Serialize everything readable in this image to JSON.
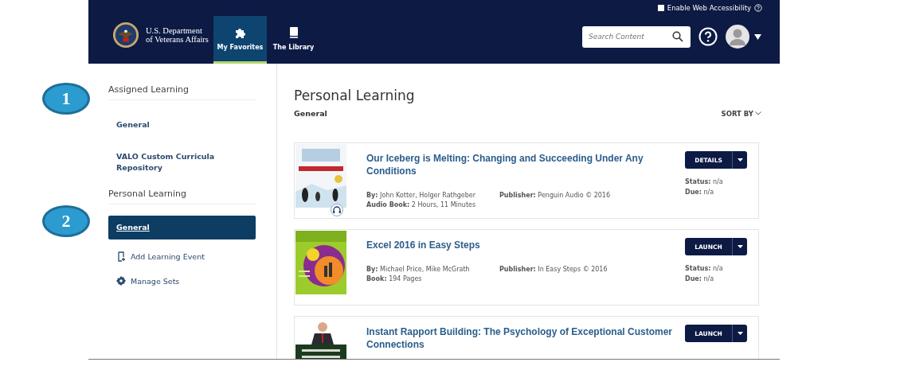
{
  "header": {
    "agency_lines": [
      "U.S. Department",
      "of Veterans Affairs"
    ],
    "accessibility": {
      "label": "Enable Web Accessibility",
      "checked": false
    },
    "tabs": [
      {
        "label": "My Favorites",
        "selected": true
      },
      {
        "label": "The Library",
        "selected": false
      }
    ],
    "search": {
      "placeholder": "Search Content"
    }
  },
  "callouts": [
    "1",
    "2"
  ],
  "sidebar": {
    "sections": [
      {
        "title": "Assigned Learning",
        "items": [
          {
            "label": "General",
            "selected": false
          },
          {
            "label": "VALO Custom Curricula Repository",
            "selected": false
          }
        ]
      },
      {
        "title": "Personal Learning",
        "items": [
          {
            "label": "General",
            "selected": true
          }
        ]
      }
    ],
    "actions": [
      {
        "kind": "add",
        "label": "Add Learning Event"
      },
      {
        "kind": "gear",
        "label": "Manage Sets"
      }
    ]
  },
  "content": {
    "title": "Personal Learning",
    "subtitle": "General",
    "sort_label": "SORT BY",
    "items": [
      {
        "audio_badge": true,
        "title": "Our Iceberg is Melting: Changing and Succeeding Under Any Conditions",
        "by_label": "By:",
        "authors": "John Kotter, Holger Rathgeber",
        "publisher_label": "Publisher:",
        "publisher": "Penguin Audio © 2016",
        "format_label": "Audio Book:",
        "format_value": "2 Hours, 11 Minutes",
        "button": "DETAILS",
        "status_label": "Status:",
        "status": "n/a",
        "due_label": "Due:",
        "due": "n/a"
      },
      {
        "audio_badge": false,
        "title": "Excel 2016 in Easy Steps",
        "by_label": "By:",
        "authors": "Michael Price, Mike McGrath",
        "publisher_label": "Publisher:",
        "publisher": "In Easy Steps © 2016",
        "format_label": "Book:",
        "format_value": "194 Pages",
        "button": "LAUNCH",
        "status_label": "Status:",
        "status": "n/a",
        "due_label": "Due:",
        "due": "n/a"
      },
      {
        "audio_badge": false,
        "title": "Instant Rapport Building: The Psychology of Exceptional Customer Connections",
        "button": "LAUNCH"
      }
    ]
  }
}
